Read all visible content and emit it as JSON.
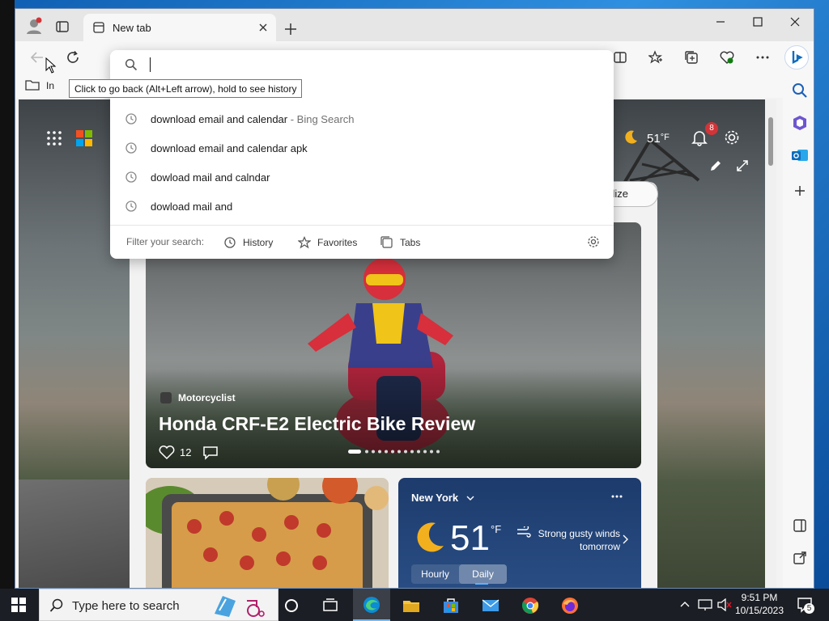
{
  "browser": {
    "tab_title": "New tab",
    "tooltip": "Click to go back (Alt+Left arrow), hold to see history",
    "favorites_partial_label": "In"
  },
  "omnibox": {
    "query": "",
    "suggestions": [
      {
        "text": "download email and calendar",
        "suffix": " - Bing Search"
      },
      {
        "text": "download email and calendar apk",
        "suffix": ""
      },
      {
        "text": "dowload mail and calndar",
        "suffix": ""
      },
      {
        "text": "dowload mail and",
        "suffix": ""
      }
    ],
    "filter_label": "Filter your search:",
    "filters": [
      "History",
      "Favorites",
      "Tabs"
    ]
  },
  "newtab": {
    "weather_temp": "51",
    "weather_unit": "°F",
    "notification_count": "8",
    "personalize_partial": "nalize"
  },
  "hero": {
    "source": "Motorcyclist",
    "title": "Honda CRF-E2 Electric Bike Review",
    "likes": "12"
  },
  "weather_card": {
    "city": "New York",
    "temp": "51",
    "unit": "°F",
    "forecast": "Strong gusty winds tomorrow",
    "tabs": [
      "Hourly",
      "Daily"
    ],
    "active_tab": "Daily"
  },
  "taskbar": {
    "search_placeholder": "Type here to search",
    "time": "9:51 PM",
    "date": "10/15/2023",
    "notification_badge": "5"
  },
  "colors": {
    "accent": "#0f6cbd",
    "badge": "#d13438",
    "taskbar": "#1b1e24"
  }
}
